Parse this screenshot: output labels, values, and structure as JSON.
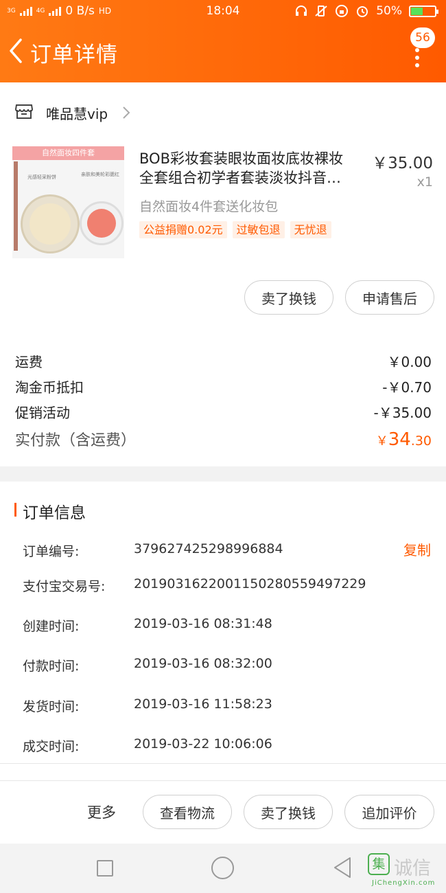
{
  "status_bar": {
    "network_left": "3G",
    "network_right": "4G",
    "speed": "0 B/s",
    "hd": "HD",
    "time": "18:04",
    "battery": "50%",
    "battery_level": 0.5
  },
  "nav": {
    "title": "订单详情",
    "badge": "56"
  },
  "shop": {
    "name": "唯品慧vip"
  },
  "product": {
    "image_band": "自然面妆四件套",
    "image_label_1": "光感轻采粉饼",
    "image_label_2": "亲肤和美轮彩腮红",
    "title_line1": "BOB彩妆套装眼妆面妆底妆裸妆",
    "title_line2": "全套组合初学者套装淡妆抖音…",
    "price": "￥35.00",
    "quantity": "x1",
    "spec": "自然面妆4件套送化妆包",
    "tags": [
      "公益捐赠0.02元",
      "过敏包退",
      "无忧退"
    ],
    "buttons": {
      "sell": "卖了换钱",
      "aftersale": "申请售后"
    }
  },
  "fees": {
    "shipping_label": "运费",
    "shipping_value": "￥0.00",
    "coin_label": "淘金币抵扣",
    "coin_value": "-￥0.70",
    "promo_label": "促销活动",
    "promo_value": "-￥35.00",
    "total_label": "实付款（含运费）",
    "total_currency": "￥",
    "total_integer": "34",
    "total_decimal": ".30"
  },
  "order_info": {
    "section_title": "订单信息",
    "copy_label": "复制",
    "rows": [
      {
        "key": "订单编号:",
        "value": "379627425298996884"
      },
      {
        "key": "支付宝交易号:",
        "value": "2019031622001150280559497229"
      },
      {
        "key": "创建时间:",
        "value": "2019-03-16 08:31:48"
      },
      {
        "key": "付款时间:",
        "value": "2019-03-16 08:32:00"
      },
      {
        "key": "发货时间:",
        "value": "2019-03-16 11:58:23"
      },
      {
        "key": "成交时间:",
        "value": "2019-03-22 10:06:06"
      }
    ]
  },
  "bottom_bar": {
    "more": "更多",
    "logistics": "查看物流",
    "sell": "卖了换钱",
    "review": "追加评价"
  },
  "watermark": {
    "box_char": "集",
    "chars": "诚信",
    "url": "JiChengXin.com"
  },
  "colors": {
    "accent": "#ff5a00",
    "header_gradient_start": "#ff7a14"
  }
}
